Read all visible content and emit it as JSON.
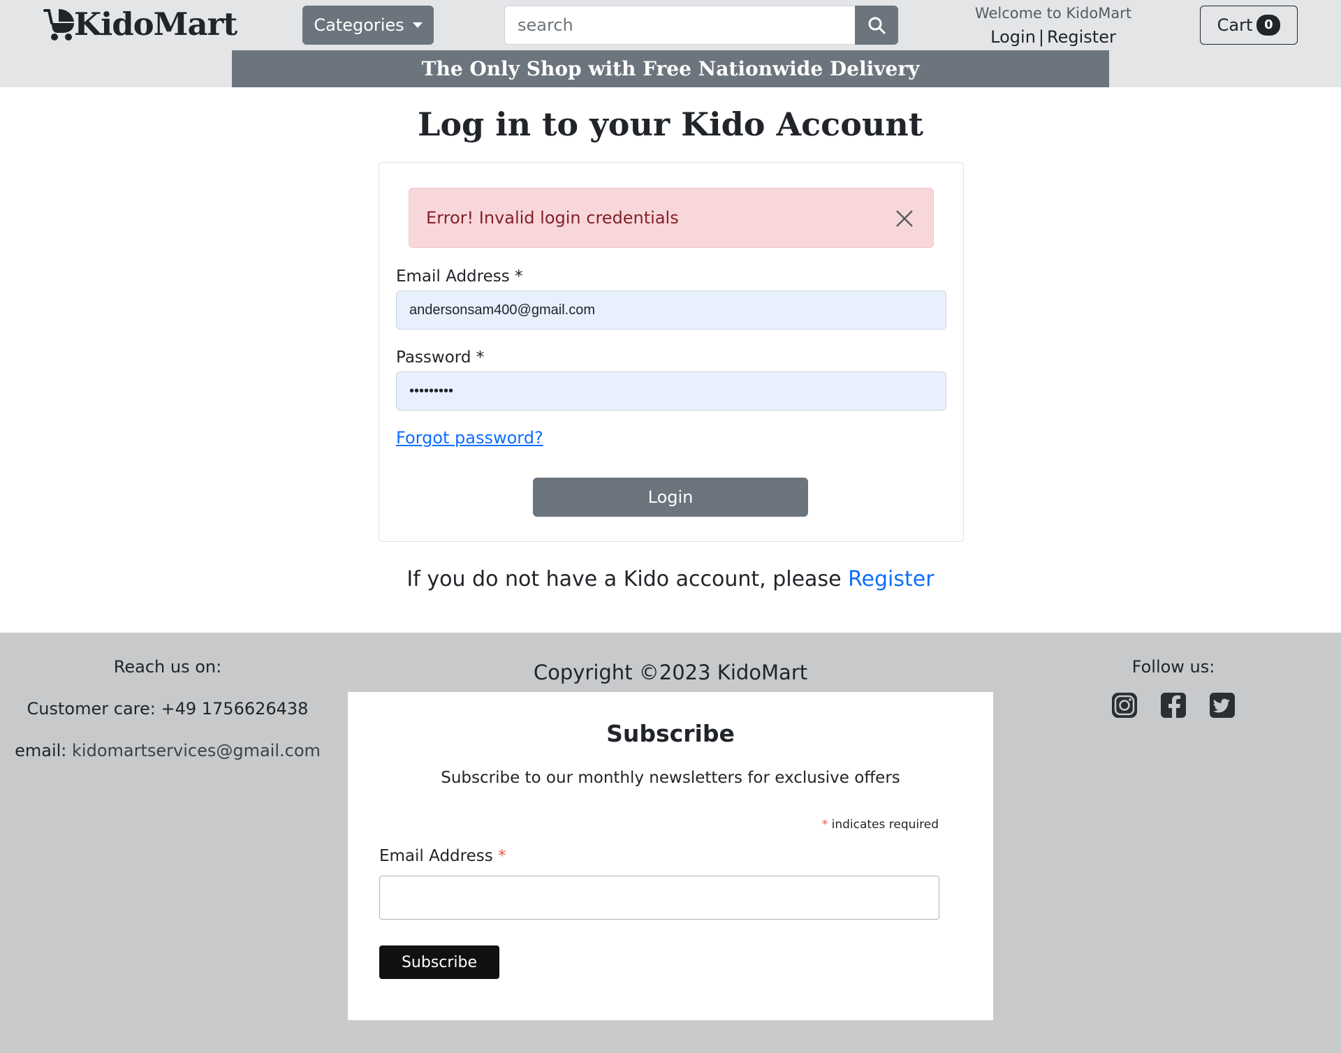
{
  "header": {
    "brand": "KidoMart",
    "categories_label": "Categories",
    "search_placeholder": "search",
    "welcome_text": "Welcome to KidoMart",
    "login_label": "Login",
    "separator": "|",
    "register_label": "Register",
    "cart_label": "Cart",
    "cart_count": "0",
    "promo_text": "The Only Shop with Free Nationwide Delivery"
  },
  "main": {
    "title": "Log in to your Kido Account",
    "alert_text": "Error! Invalid login credentials",
    "email_label": "Email Address *",
    "email_value": "andersonsam400@gmail.com",
    "password_label": "Password *",
    "password_value": "•••••••••",
    "forgot_label": "Forgot password?",
    "login_button": "Login",
    "register_prompt": "If you do not have a Kido account, please ",
    "register_link": "Register"
  },
  "footer": {
    "reach_title": "Reach us on:",
    "customer_care": "Customer care: +49 1756626438",
    "email_prefix": "email: ",
    "email_value": "kidomartservices@gmail.com",
    "copyright": "Copyright ©2023 KidoMart",
    "follow_title": "Follow us:",
    "social_icons": [
      "instagram-icon",
      "facebook-icon",
      "twitter-icon"
    ]
  },
  "subscribe": {
    "title": "Subscribe",
    "description": "Subscribe to our monthly newsletters for exclusive offers",
    "required_star": "*",
    "required_note": " indicates required",
    "email_label": "Email Address ",
    "email_star": "*",
    "button_label": "Subscribe"
  },
  "colors": {
    "header_bg": "#e4e5e7",
    "secondary": "#6c757d",
    "link": "#0d6efd",
    "alert_bg": "#f8d7da",
    "alert_text": "#842029",
    "footer_bg": "#c8c9ca"
  }
}
